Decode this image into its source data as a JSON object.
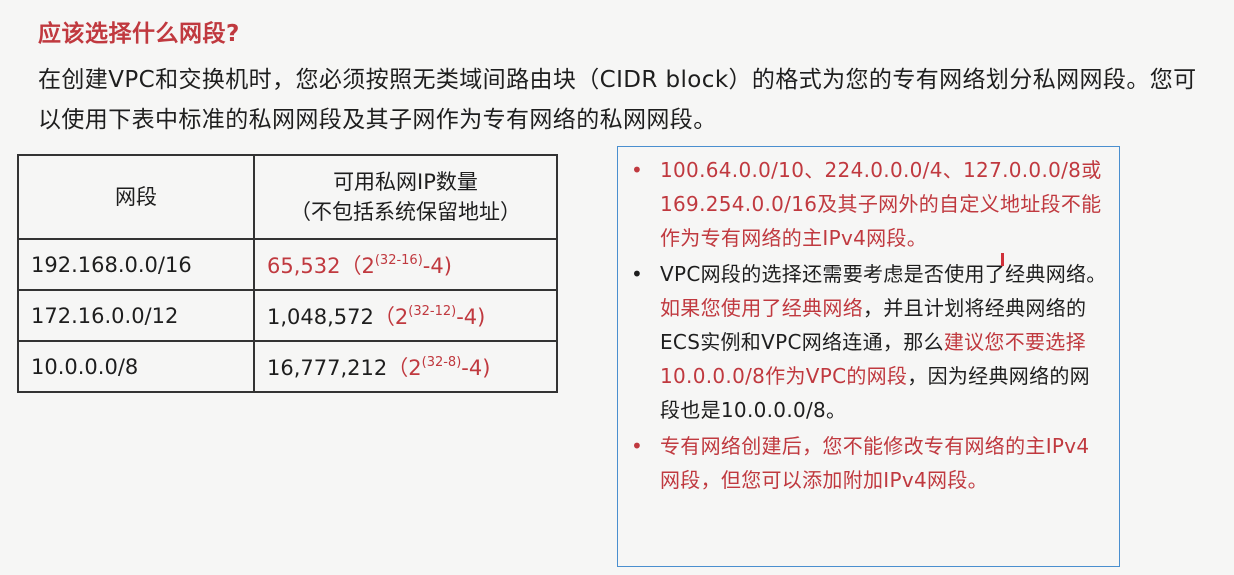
{
  "heading": "应该选择什么网段?",
  "intro": "在创建VPC和交换机时，您必须按照无类域间路由块（CIDR block）的格式为您的专有网络划分私网网段。您可以使用下表中标准的私网网段及其子网作为专有网络的私网网段。",
  "table": {
    "header_col1": "网段",
    "header_col2_line1": "可用私网IP数量",
    "header_col2_line2": "（不包括系统保留地址）",
    "rows": [
      {
        "segment": "192.168.0.0/16",
        "count": "65,532",
        "formula_open": "（2",
        "exponent": "(32-16)",
        "formula_close": "-4)"
      },
      {
        "segment": "172.16.0.0/12",
        "count": "1,048,572",
        "formula_open": "（2",
        "exponent": "(32-12)",
        "formula_close": "-4)"
      },
      {
        "segment": "10.0.0.0/8",
        "count": "16,777,212",
        "formula_open": "（2",
        "exponent": "(32-8)",
        "formula_close": "-4)"
      }
    ]
  },
  "notes": {
    "bullet": "•",
    "note1": "100.64.0.0/10、224.0.0.0/4、127.0.0.0/8或169.254.0.0/16及其子网外的自定义地址段不能作为专有网络的主IPv4网段。",
    "note2_part1": "VPC网段的选择还需要考虑是否使用了经典网络。",
    "note2_part2": "如果您使用了经典网络",
    "note2_part3": "，并且计划将经典网络的ECS实例和VPC网络连通，那么",
    "note2_part4": "建议您不要选择10.0.0.0/8作为VPC的网段",
    "note2_part5": "，因为经典网络的网段也是10.0.0.0/8。",
    "note3": "专有网络创建后，您不能修改专有网络的主IPv4网段，但您可以添加附加IPv4网段。"
  },
  "colors": {
    "accent_red": "#c0393f",
    "box_border": "#4a8fcf",
    "text": "#1e1e1e"
  }
}
